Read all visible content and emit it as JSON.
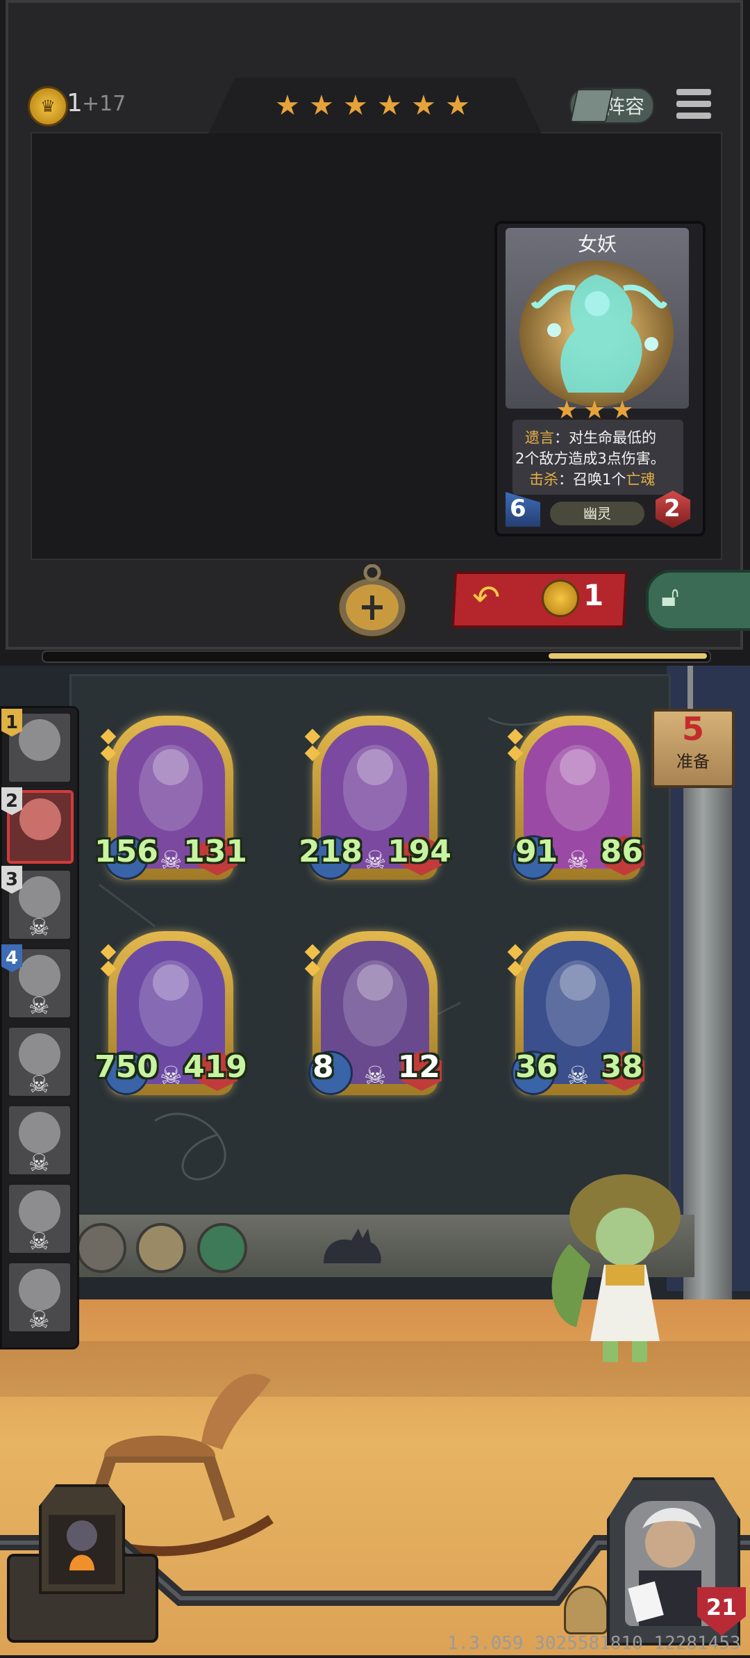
{
  "shop": {
    "gold": "1",
    "gold_income": "+17",
    "tavern_stars": 6,
    "lineup_label": "阵容",
    "menu_icon": "hamburger-menu-icon",
    "refresh_cost": "1",
    "refresh_icon": "refresh-arrow-icon",
    "freeze_icon": "lock-icon",
    "timer_icon": "pocket-watch-icon"
  },
  "detail_card": {
    "name": "女妖",
    "stars": 3,
    "deathrattle_keyword": "遗言",
    "deathrattle_text_1": "：对生命最低的",
    "deathrattle_text_2": "2个敌方造成3点伤害。",
    "kill_keyword": "击杀",
    "kill_text_1": "：召唤1个",
    "kill_text_2": "亡魂",
    "attack": "6",
    "health": "2",
    "tribe": "幽灵"
  },
  "board": {
    "units": [
      {
        "name": "bell-ghost-witch",
        "attack": "156",
        "health": "131",
        "art_color": "#7b4aa0"
      },
      {
        "name": "bell-ghost-witch",
        "attack": "218",
        "health": "194",
        "art_color": "#7b4aa0"
      },
      {
        "name": "pink-lady",
        "attack": "91",
        "health": "86",
        "art_color": "#9a4aa4"
      },
      {
        "name": "banshee",
        "attack": "750",
        "health": "419",
        "art_color": "#6c4aa4"
      },
      {
        "name": "donkey-bard",
        "attack": "8",
        "health": "12",
        "art_color": "#6a4a8e"
      },
      {
        "name": "dragon-beast",
        "attack": "36",
        "health": "38",
        "art_color": "#3b4f8c"
      }
    ],
    "prep_timer": "5",
    "prep_label": "准备"
  },
  "players": [
    {
      "rank": "1",
      "tag_color": "#e0b143",
      "alive": true,
      "highlight": false
    },
    {
      "rank": "2",
      "tag_color": "#d8d8d8",
      "alive": true,
      "highlight": true
    },
    {
      "rank": "3",
      "tag_color": "#d8d8d8",
      "alive": false,
      "highlight": false
    },
    {
      "rank": "4",
      "tag_color": "#3e6cb5",
      "alive": false,
      "highlight": false
    },
    {
      "rank": "",
      "tag_color": "",
      "alive": false,
      "highlight": false
    },
    {
      "rank": "",
      "tag_color": "",
      "alive": false,
      "highlight": false
    },
    {
      "rank": "",
      "tag_color": "",
      "alive": false,
      "highlight": false
    },
    {
      "rank": "",
      "tag_color": "",
      "alive": false,
      "highlight": false
    }
  ],
  "hero": {
    "health": "21"
  },
  "version": "1.3.059 3025581810 12281453",
  "colors": {
    "accent_gold": "#e6a33a",
    "refresh_red": "#b5252c",
    "freeze_green": "#3b6b54",
    "stat_green": "#c8f3a0"
  }
}
